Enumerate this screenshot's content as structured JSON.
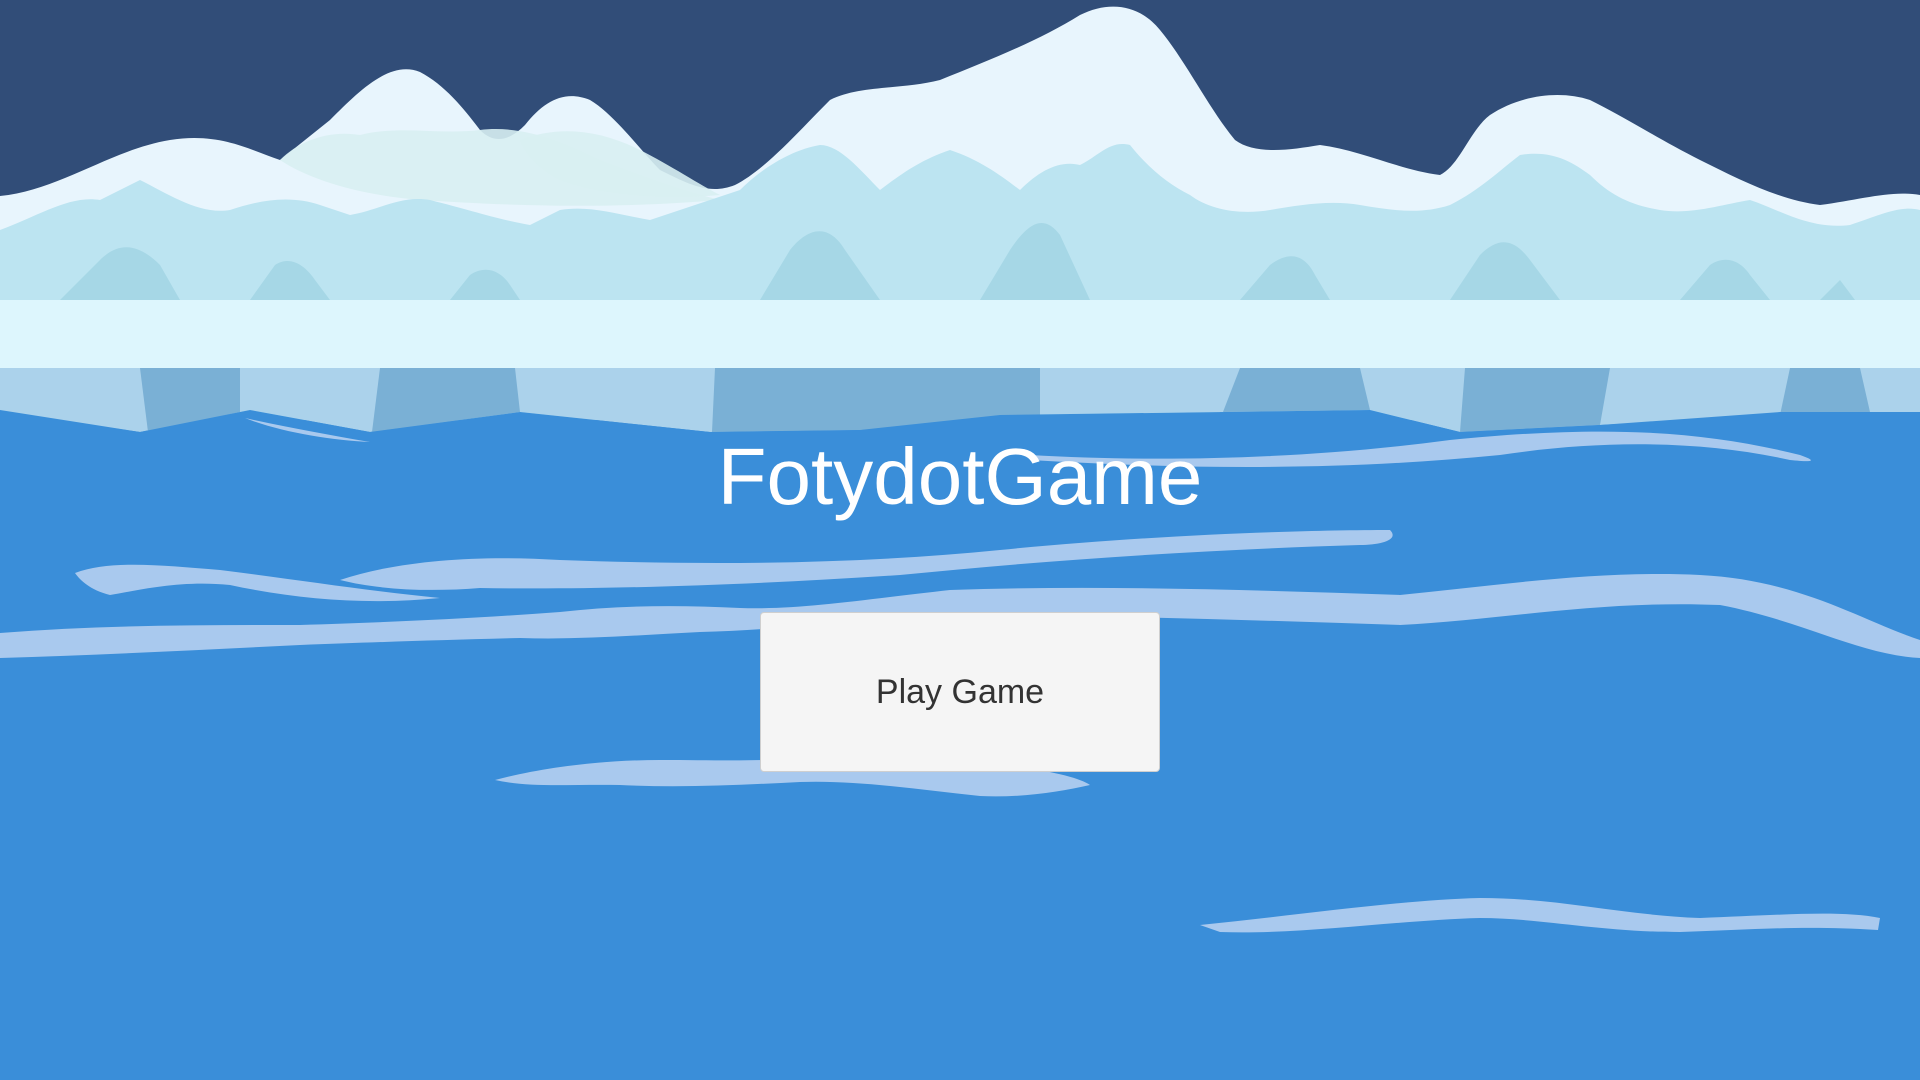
{
  "game": {
    "title": "FotydotGame"
  },
  "menu": {
    "play_button_label": "Play Game"
  },
  "colors": {
    "sky": "#314d78",
    "snow": "#e8f5fd",
    "ice_light": "#bce4f1",
    "ice_mid": "#a6d7e6",
    "ice_shelf": "#ddf6fd",
    "ice_face": "#abd2eb",
    "ice_face_dark": "#7ab0d5",
    "water": "#3a8ed9",
    "wave": "#a9c9ee",
    "title_text": "#ffffff",
    "button_bg": "#f5f5f5",
    "button_text": "#333333"
  }
}
